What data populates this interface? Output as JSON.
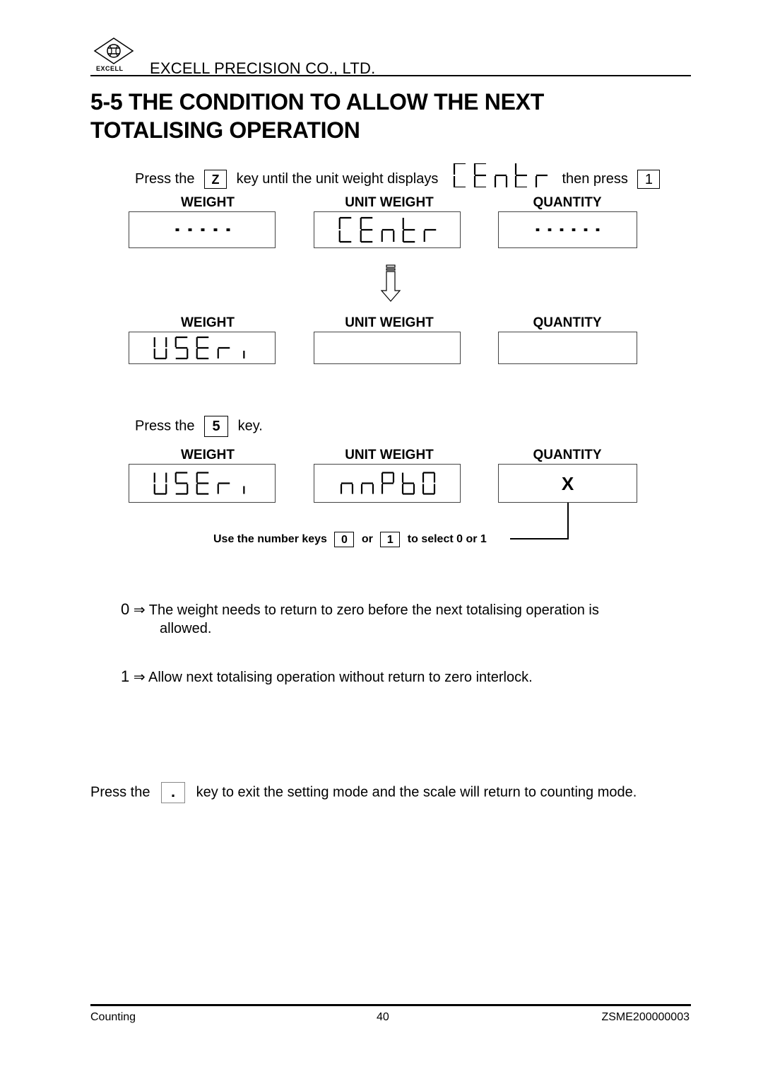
{
  "header": {
    "logo_text": "EXCELL",
    "logo_icon": "excell-diamond-logo-icon",
    "company": "EXCELL PRECISION CO., LTD."
  },
  "title": {
    "line1": "5-5 THE CONDITION TO ALLOW THE NEXT",
    "line2": "TOTALISING OPERATION"
  },
  "step1": {
    "text_a": "Press the",
    "key": "Z",
    "text_b": "key until the unit weight displays",
    "display": "CEntr",
    "text_c": "then press",
    "key2": "1"
  },
  "labels": {
    "weight": "WEIGHT",
    "unit_weight": "UNIT WEIGHT",
    "quantity": "QUANTITY"
  },
  "panels": {
    "row1": {
      "weight": "-----",
      "unit_weight": "CEntr",
      "quantity": "------"
    },
    "row2": {
      "weight": "USEr1",
      "unit_weight": "",
      "quantity": ""
    },
    "row3": {
      "weight": "USEr1",
      "unit_weight": "nnPb0",
      "quantity": "X"
    }
  },
  "arrow_icon": "down-arrow-icon",
  "step2": {
    "text_a": "Press the",
    "key": "5",
    "text_b": "key."
  },
  "note": {
    "text_a": "Use the number keys",
    "key_a": "0",
    "text_b": "or",
    "key_b": "1",
    "text_c": "to select 0 or 1"
  },
  "options": [
    {
      "value": "0",
      "arrow": "⇒",
      "text": "The weight needs to return to zero before the next totalising operation is",
      "text2": "allowed."
    },
    {
      "value": "1",
      "arrow": "⇒",
      "text": "Allow next totalising operation without return to zero interlock."
    }
  ],
  "exit": {
    "text_a": "Press the",
    "key": ".",
    "text_b": "key to exit the setting mode and the scale will return to counting mode."
  },
  "footer": {
    "left": "Counting",
    "center": "40",
    "right": "ZSME200000003"
  }
}
